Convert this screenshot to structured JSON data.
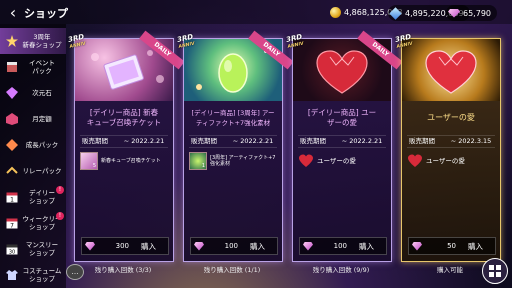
{
  "header": {
    "title": "ショップ",
    "currencies": [
      {
        "icon": "gold-coin-icon",
        "value": "4,868,125,043"
      },
      {
        "icon": "blue-gem-icon",
        "value": "4,895,220,669"
      },
      {
        "icon": "pink-stone-icon",
        "value": "65,790"
      }
    ]
  },
  "sidebar": {
    "items": [
      {
        "label": "3周年\n新春ショップ",
        "icon": "star-icon",
        "active": true
      },
      {
        "label": "イベント\nパック",
        "icon": "event-icon"
      },
      {
        "label": "次元石",
        "icon": "dimension-stone-icon"
      },
      {
        "label": "月定額",
        "icon": "monthly-icon"
      },
      {
        "label": "成長パック",
        "icon": "growth-icon"
      },
      {
        "label": "リレーパック",
        "icon": "relay-icon"
      },
      {
        "label": "デイリー\nショップ",
        "icon": "calendar-1-icon",
        "badge": "!"
      },
      {
        "label": "ウィークリー\nショップ",
        "icon": "calendar-7-icon",
        "badge": "!"
      },
      {
        "label": "マンスリー\nショップ",
        "icon": "calendar-30-icon"
      },
      {
        "label": "コスチューム\nショップ",
        "icon": "costume-icon"
      }
    ]
  },
  "cards": [
    {
      "anniv": "3RD",
      "anniv_sub": "ANNIV",
      "ribbon": "DAILY",
      "name": "[デイリー商品] 新春\nキューブ召喚チケット",
      "period_label": "販売期間",
      "period": "~ 2022.2.21",
      "content": "新春キューブ召喚チケット",
      "content_count": "5",
      "price": "300",
      "buy": "購入",
      "limit": "残り購入回数 (3/3)",
      "style": "purple"
    },
    {
      "anniv": "3RD",
      "anniv_sub": "ANNIV",
      "ribbon": "DAILY",
      "name": "[デイリー商品] [3周年] アー\nティファクト+7強化素材",
      "period_label": "販売期間",
      "period": "~ 2022.2.21",
      "content": "[3周年] アーティファクト+7強化素材",
      "content_count": "1",
      "price": "100",
      "buy": "購入",
      "limit": "残り購入回数 (1/1)",
      "style": "purple"
    },
    {
      "anniv": "3RD",
      "anniv_sub": "ANNIV",
      "ribbon": "DAILY",
      "name": "[デイリー商品] ユー\nザーの愛",
      "period_label": "販売期間",
      "period": "~ 2022.2.21",
      "content": "ユーザーの愛",
      "content_count": "",
      "price": "100",
      "buy": "購入",
      "limit": "残り購入回数 (9/9)",
      "style": "purple"
    },
    {
      "anniv": "3RD",
      "anniv_sub": "ANNIV",
      "ribbon": "",
      "name": "ユーザーの愛",
      "period_label": "販売期間",
      "period": "~ 2022.3.15",
      "content": "ユーザーの愛",
      "content_count": "",
      "price": "50",
      "buy": "購入",
      "limit": "購入可能",
      "style": "gold"
    }
  ]
}
